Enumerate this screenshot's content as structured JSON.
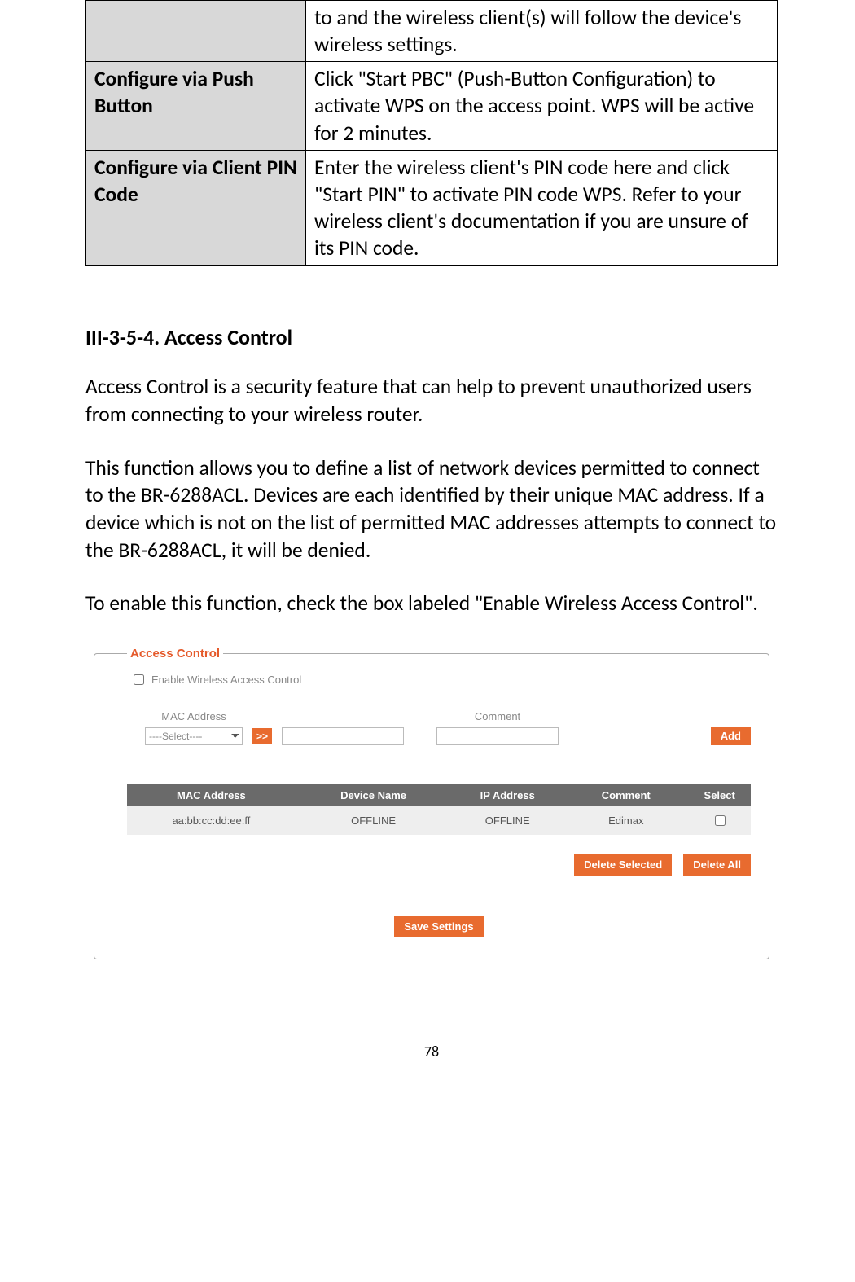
{
  "def_table": {
    "rows": [
      {
        "label": "",
        "desc": "to and the wireless client(s) will follow the device's wireless settings."
      },
      {
        "label": "Configure via Push Button",
        "desc": "Click \"Start PBC\" (Push-Button Configuration) to activate WPS on the access point. WPS will be active for 2 minutes."
      },
      {
        "label": "Configure via Client PIN Code",
        "desc": "Enter the wireless client's PIN code here and click \"Start PIN\" to activate PIN code WPS. Refer to your wireless client's documentation if you are unsure of its PIN code."
      }
    ]
  },
  "section_heading": "III-3-5-4.    Access Control",
  "para1": "Access Control is a security feature that can help to prevent unauthorized users from connecting to your wireless router.",
  "para2": "This function allows you to define a list of network devices permitted to connect to the BR-6288ACL. Devices are each identified by their unique MAC address. If a device which is not on the list of permitted MAC addresses attempts to connect to the BR-6288ACL, it will be denied.",
  "para3": "To enable this function, check the box labeled \"Enable Wireless Access Control\".",
  "panel": {
    "legend": "Access Control",
    "enable_label": "Enable Wireless Access Control",
    "mac_label": "MAC Address",
    "select_placeholder": "----Select----",
    "arrow_label": ">>",
    "comment_label": "Comment",
    "add_label": "Add",
    "table": {
      "headers": [
        "MAC Address",
        "Device Name",
        "IP Address",
        "Comment",
        "Select"
      ],
      "rows": [
        {
          "mac": "aa:bb:cc:dd:ee:ff",
          "device": "OFFLINE",
          "ip": "OFFLINE",
          "comment": "Edimax"
        }
      ]
    },
    "delete_selected": "Delete Selected",
    "delete_all": "Delete All",
    "save": "Save Settings"
  },
  "page_number": "78"
}
